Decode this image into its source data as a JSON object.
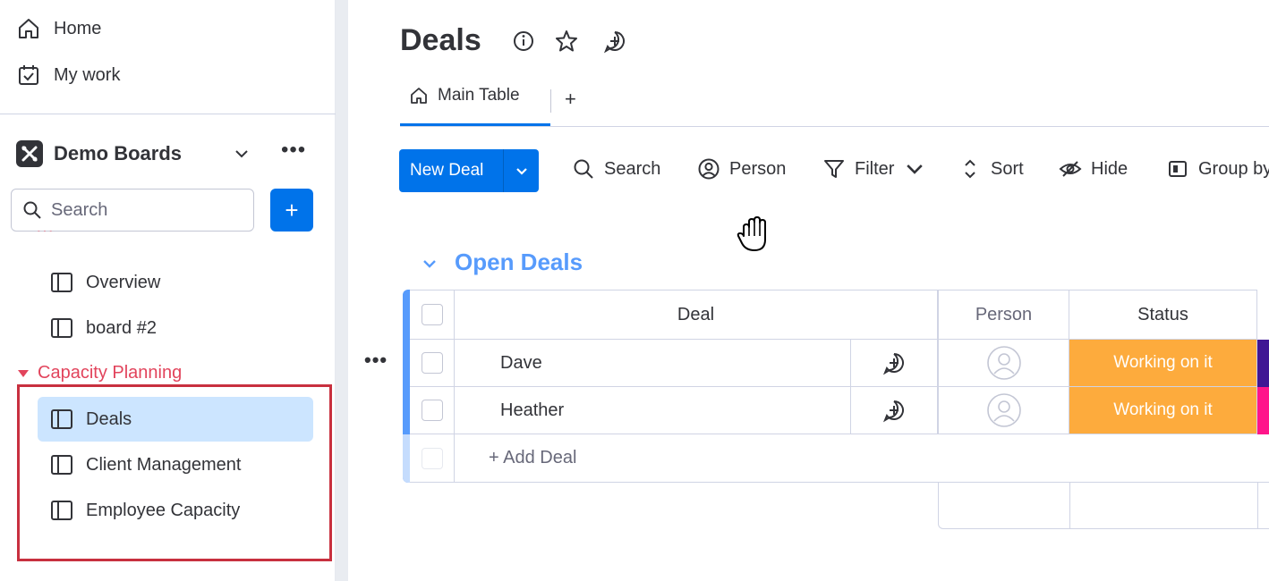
{
  "sidebar": {
    "nav": [
      {
        "label": "Home",
        "icon": "home-icon"
      },
      {
        "label": "My work",
        "icon": "calendar-check-icon"
      }
    ],
    "workspace": {
      "name": "Demo Boards",
      "more": "•••"
    },
    "search_placeholder": "Search",
    "add_label": "+",
    "boards": [
      {
        "label": "Overview"
      },
      {
        "label": "board #2"
      }
    ],
    "folder": {
      "label": "Capacity Planning",
      "color": "#e2445c"
    },
    "folder_boards": [
      {
        "label": "Deals",
        "active": true
      },
      {
        "label": "Client Management"
      },
      {
        "label": "Employee Capacity"
      }
    ]
  },
  "board": {
    "title": "Deals",
    "tabs": [
      {
        "label": "Main Table"
      }
    ],
    "add_tab": "+"
  },
  "toolbar": {
    "new_item": "New Deal",
    "search": "Search",
    "person": "Person",
    "filter": "Filter",
    "sort": "Sort",
    "hide": "Hide",
    "group_by": "Group by"
  },
  "group": {
    "title": "Open Deals",
    "color": "#579bfc",
    "columns": {
      "deal": "Deal",
      "person": "Person",
      "status": "Status"
    },
    "rows": [
      {
        "name": "Dave",
        "status": "Working on it",
        "status_color": "#fdab3d",
        "edge_color": "#401694"
      },
      {
        "name": "Heather",
        "status": "Working on it",
        "status_color": "#fdab3d",
        "edge_color": "#ff158a"
      }
    ],
    "add_item": "+ Add Deal",
    "row_more": "•••"
  },
  "colors": {
    "primary": "#0073ea",
    "selected": "#cce5ff",
    "highlight_box": "#c8303f"
  }
}
